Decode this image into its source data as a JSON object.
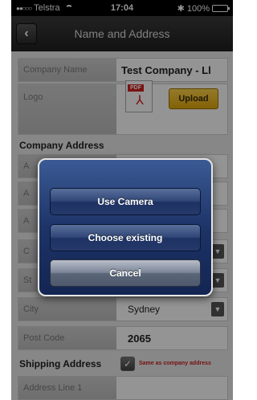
{
  "status_bar": {
    "signal": "●●○○○",
    "carrier": "Telstra",
    "time": "17:04",
    "bluetooth": "✱",
    "battery_text": "100%",
    "battery_level": 1.0
  },
  "nav": {
    "back_glyph": "‹",
    "title": "Name and Address"
  },
  "form": {
    "company_name_label": "Company Name",
    "company_name_value": "Test Company - Ll",
    "logo_label": "Logo",
    "pdf_tag": "PDF",
    "upload_label": "Upload",
    "company_address_title": "Company Address",
    "address_line_partial_1": "A",
    "address_line_partial_2": "A",
    "address_line_partial_3": "A",
    "country_partial": "C",
    "state_partial": "St",
    "city_label": "City",
    "city_value": "Sydney",
    "post_code_label": "Post Code",
    "post_code_value": "2065",
    "shipping_address_title": "Shipping Address",
    "same_as_company_label": "Same as company address",
    "shipping_line1_label": "Address Line 1"
  },
  "action_sheet": {
    "use_camera": "Use Camera",
    "choose_existing": "Choose existing",
    "cancel": "Cancel"
  }
}
